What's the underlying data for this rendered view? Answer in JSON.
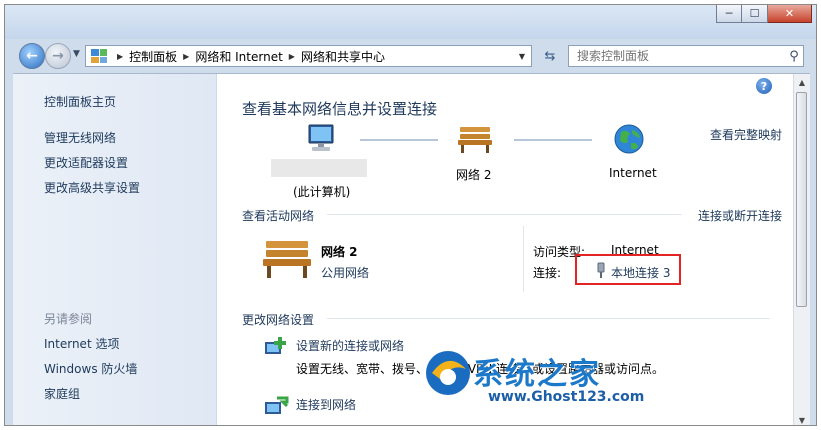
{
  "window": {
    "minimize_glyph": "─",
    "maximize_glyph": "☐",
    "close_glyph": "✕"
  },
  "address": {
    "crumbs": [
      "控制面板",
      "网络和 Internet",
      "网络和共享中心"
    ],
    "search_placeholder": "搜索控制面板"
  },
  "sidebar": {
    "home": "控制面板主页",
    "links": [
      "管理无线网络",
      "更改适配器设置",
      "更改高级共享设置"
    ],
    "see_also_heading": "另请参阅",
    "see_also": [
      "Internet 选项",
      "Windows 防火墙",
      "家庭组"
    ]
  },
  "main": {
    "help_glyph": "?",
    "title": "查看基本网络信息并设置连接",
    "full_map_link": "查看完整映射",
    "map": {
      "computer_label": "(此计算机)",
      "network_label": "网络  2",
      "internet_label": "Internet"
    },
    "active_heading": "查看活动网络",
    "connect_link": "连接或断开连接",
    "active_network": {
      "name": "网络  2",
      "type_link": "公用网络",
      "access_type_label": "访问类型:",
      "access_type_value": "Internet",
      "connection_label": "连接:",
      "connection_link": "本地连接 3"
    },
    "change_heading": "更改网络设置",
    "tasks": [
      {
        "title": "设置新的连接或网络",
        "desc": "设置无线、宽带、拨号、临时或 VPN 连接；或设置路由器或访问点。"
      },
      {
        "title": "连接到网络",
        "desc": ""
      }
    ]
  },
  "watermark": {
    "brand": "系统之家",
    "url": "www.Ghost123.com"
  },
  "colors": {
    "link": "#0066cc",
    "text": "#1e395b",
    "highlight_box": "#e42424"
  }
}
